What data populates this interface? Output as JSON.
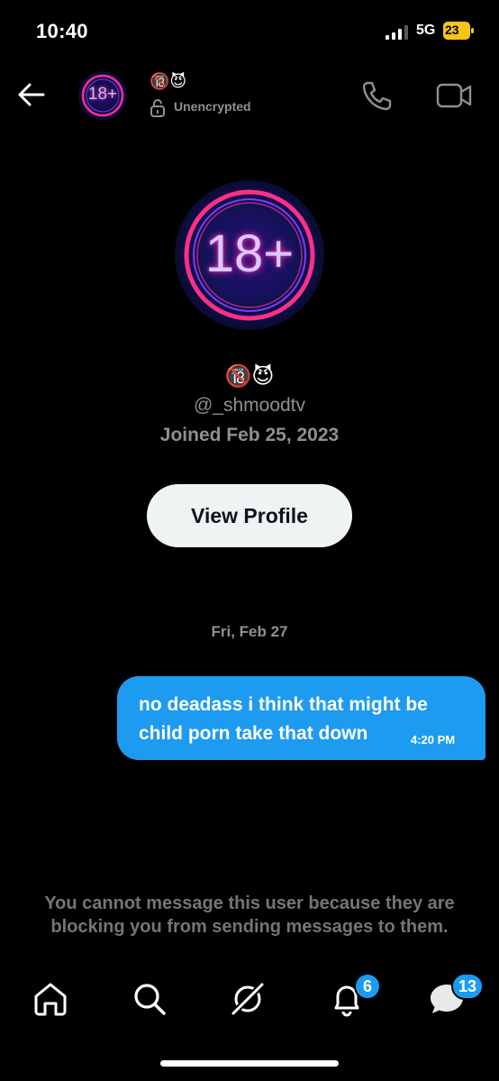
{
  "status_bar": {
    "time": "10:40",
    "network": "5G",
    "battery": "23"
  },
  "header": {
    "avatar_text": "18+",
    "display_name": "🔞😈",
    "encryption_label": "Unencrypted"
  },
  "profile": {
    "avatar_text": "18+",
    "display_name": "🔞😈",
    "handle": "@_shmoodtv",
    "joined": "Joined Feb 25, 2023",
    "view_profile_label": "View Profile"
  },
  "conversation": {
    "date_divider": "Fri, Feb 27",
    "messages": [
      {
        "text": "no deadass i think that might be child porn take that down",
        "time": "4:20 PM",
        "sender": "me"
      }
    ]
  },
  "blocked_notice": "You cannot message this user because they are blocking you from sending messages to them.",
  "tab_bar": {
    "tabs": [
      {
        "icon": "home-icon"
      },
      {
        "icon": "search-icon"
      },
      {
        "icon": "grok-icon"
      },
      {
        "icon": "bell-icon",
        "badge": "6"
      },
      {
        "icon": "messages-icon",
        "badge": "13"
      }
    ]
  },
  "colors": {
    "accent": "#1d9bf0",
    "neon_pink": "#ff2e88",
    "neon_blue": "#3b4dff",
    "muted": "#71767b"
  }
}
